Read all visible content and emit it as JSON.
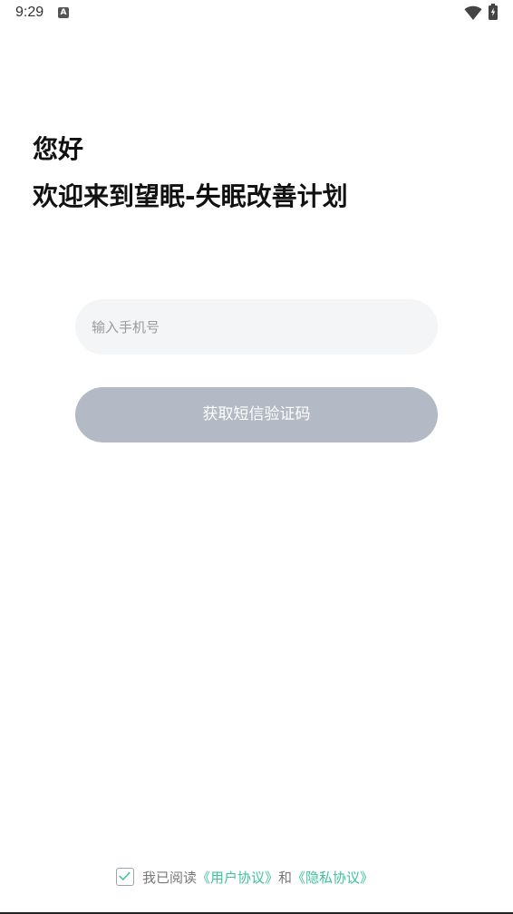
{
  "status_bar": {
    "time": "9:29",
    "notification_icon": "A"
  },
  "heading": {
    "greeting": "您好",
    "welcome": "欢迎来到望眠-失眠改善计划"
  },
  "form": {
    "phone_placeholder": "输入手机号",
    "phone_value": "",
    "code_button_label": "获取短信验证码"
  },
  "agreement": {
    "checked": true,
    "prefix": "我已阅读",
    "user_agreement": "《用户协议》",
    "conjunction": "和",
    "privacy_policy": "《隐私协议》"
  },
  "colors": {
    "accent_link": "#3fc29a",
    "button_disabled": "#b3b9c5",
    "input_bg": "#f4f5f7"
  }
}
